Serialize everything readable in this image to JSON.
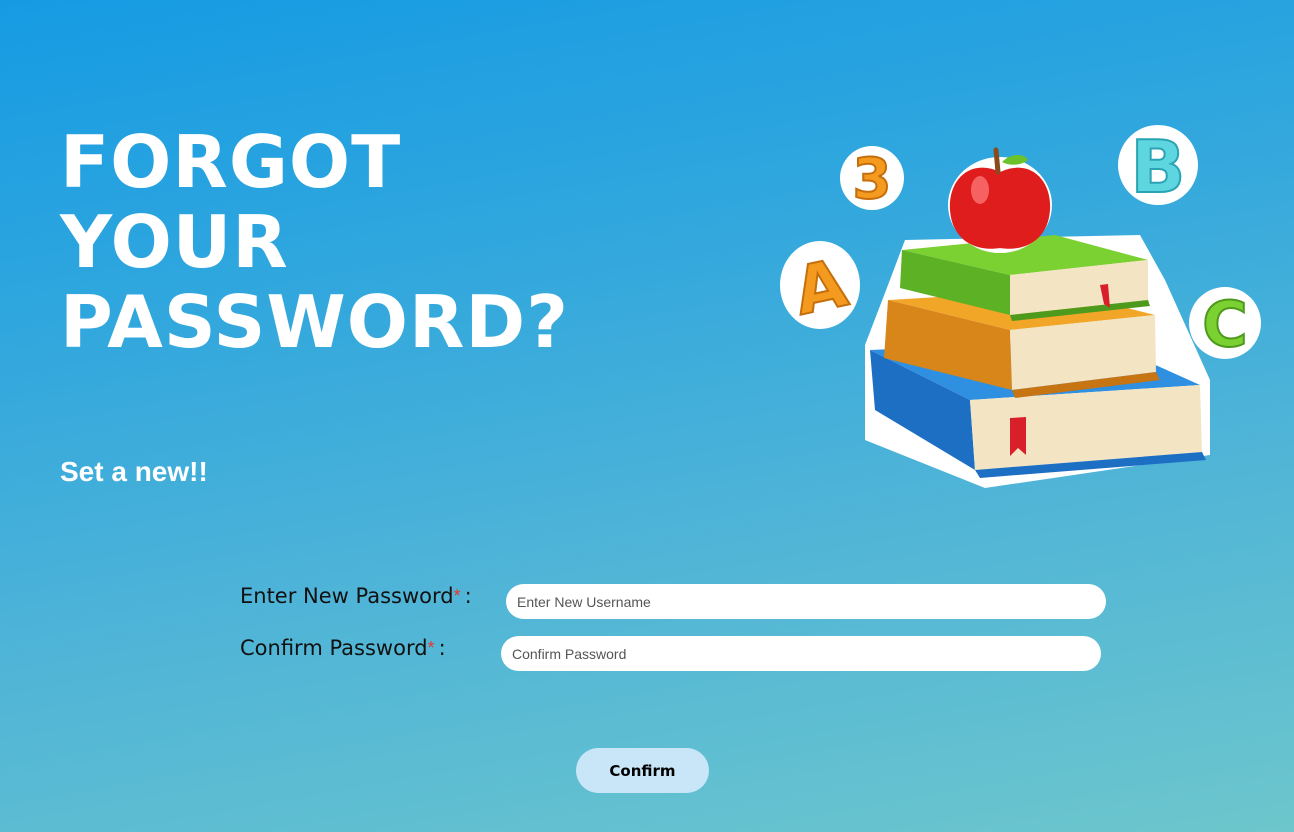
{
  "hero": {
    "title_line1": "FORGOT",
    "title_line2": "YOUR",
    "title_line3": "PASSWORD?",
    "subtitle": "Set a new!!"
  },
  "form": {
    "new_password": {
      "label": "Enter New Password",
      "required_mark": "*",
      "colon": ":",
      "placeholder": "Enter New Username",
      "value": ""
    },
    "confirm_password": {
      "label": "Confirm Password",
      "required_mark": "*",
      "colon": ":",
      "placeholder": "Confirm Password",
      "value": ""
    },
    "confirm_button_label": "Confirm"
  },
  "illustration": {
    "icon": "books-apple-abc-icon"
  },
  "colors": {
    "background_top": "#169be3",
    "background_bottom": "#6cc6cc",
    "button_bg": "#c8e6f7",
    "required_mark": "#e53935"
  }
}
